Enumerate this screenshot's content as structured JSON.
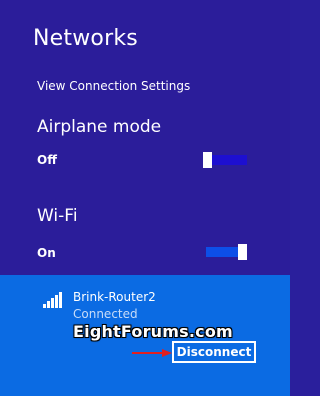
{
  "panel": {
    "title": "Networks",
    "view_settings_label": "View Connection Settings"
  },
  "airplane": {
    "label": "Airplane mode",
    "state": "Off",
    "enabled": false
  },
  "wifi": {
    "label": "Wi-Fi",
    "state": "On",
    "enabled": true
  },
  "network": {
    "name": "Brink-Router2",
    "status": "Connected",
    "signal_bars": 5,
    "signal_icon": "wifi-signal-icon",
    "disconnect_label": "Disconnect"
  },
  "watermark": {
    "text": "EightForums.com"
  },
  "colors": {
    "panel_bg": "#2b1d9a",
    "tile_bg": "#0b6be3",
    "toggle_fill": "#0d4fe8",
    "arrow": "#e02020"
  }
}
